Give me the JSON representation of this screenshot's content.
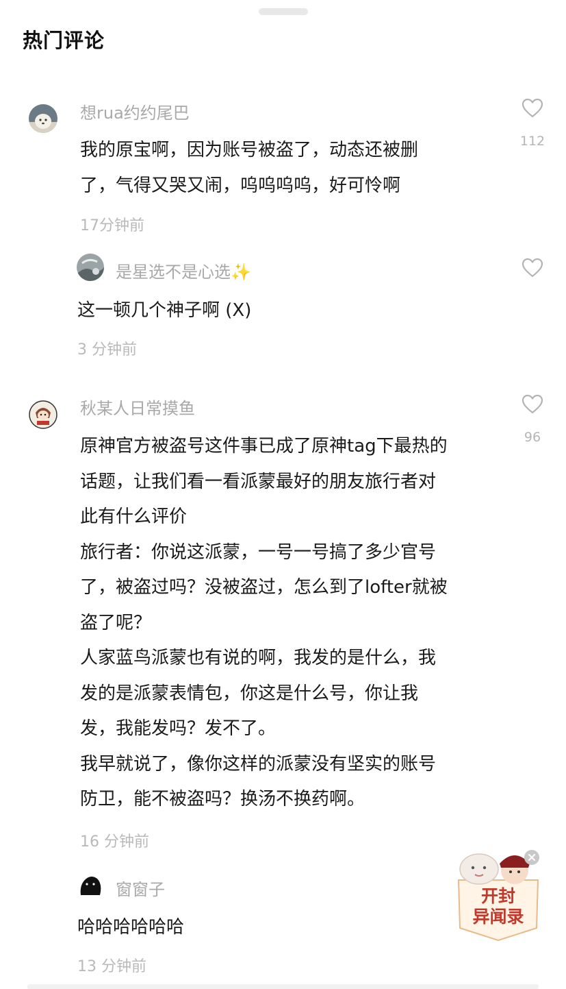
{
  "header": {
    "title": "热门评论"
  },
  "comments": [
    {
      "username": "想rua约约尾巴",
      "lines": [
        "我的原宝啊，因为账号被盗了，动态还被删",
        "了，气得又哭又闹，呜呜呜呜，好可怜啊"
      ],
      "time": "17分钟前",
      "likes": "112"
    },
    {
      "username": "是星选不是心选✨",
      "lines": [
        "这一顿几个神子啊 (X)"
      ],
      "time": "3 分钟前"
    },
    {
      "username": "秋某人日常摸鱼",
      "lines": [
        "原神官方被盗号这件事已成了原神tag下最热的",
        "话题，让我们看一看派蒙最好的朋友旅行者对",
        "此有什么评价",
        "旅行者：你说这派蒙，一号一号搞了多少官号",
        "了，被盗过吗？没被盗过，怎么到了lofter就被",
        "盗了呢？",
        "人家蓝鸟派蒙也有说的啊，我发的是什么，我",
        "发的是派蒙表情包，你这是什么号，你让我",
        "发，我能发吗？发不了。",
        "我早就说了，像你这样的派蒙没有坚实的账号",
        "防卫，能不被盗吗？换汤不换药啊。"
      ],
      "time": "16 分钟前",
      "likes": "96"
    },
    {
      "username": "窗窗子",
      "lines": [
        "哈哈哈哈哈哈"
      ],
      "time": "13 分钟前"
    }
  ],
  "banner": {
    "line1": "开封",
    "line2": "异闻录"
  },
  "icons": {
    "like": "heart-outline-icon",
    "close": "close-icon"
  },
  "colors": {
    "name": "#a9a9a9",
    "time": "#b9b9b9",
    "banner": "#c0392b"
  }
}
